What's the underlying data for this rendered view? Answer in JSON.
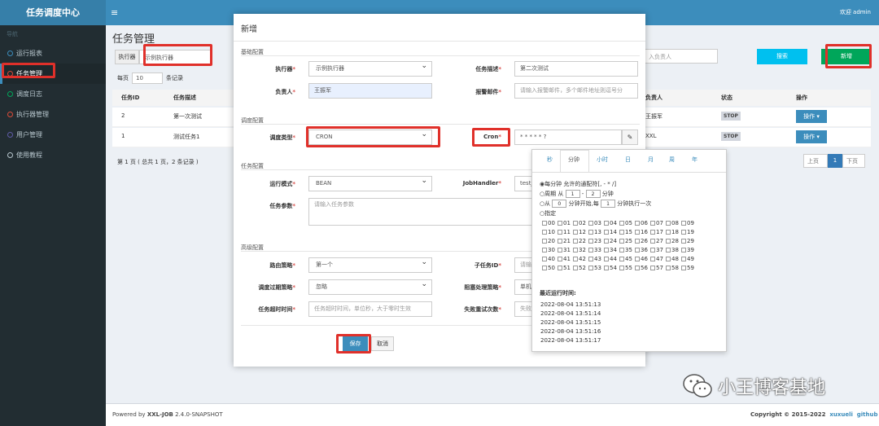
{
  "app": {
    "logo": "任务调度中心",
    "welcome": "欢迎 admin"
  },
  "sidebar": {
    "header": "导航",
    "items": [
      {
        "label": "运行报表",
        "color": "#3c8dbc"
      },
      {
        "label": "任务管理",
        "color": "#dd4b39"
      },
      {
        "label": "调度日志",
        "color": "#00a65a"
      },
      {
        "label": "执行器管理",
        "color": "#dd4b39"
      },
      {
        "label": "用户管理",
        "color": "#605ca8"
      },
      {
        "label": "使用教程",
        "color": "#b8c7ce"
      }
    ]
  },
  "page": {
    "title": "任务管理",
    "executor_label": "执行器",
    "executor_value": "示例执行器",
    "owner_placeholder": "入负责人",
    "search_btn": "搜索",
    "add_btn": "新增"
  },
  "table": {
    "per_page_prefix": "每页",
    "per_page_value": "10",
    "per_page_suffix": "条记录",
    "headers": [
      "任务ID",
      "任务描述",
      "负责人",
      "状态",
      "操作"
    ],
    "rows": [
      {
        "id": "2",
        "desc": "第一次测试",
        "owner": "王振军",
        "status": "STOP",
        "action": "操作"
      },
      {
        "id": "1",
        "desc": "测试任务1",
        "owner": "XXL",
        "status": "STOP",
        "action": "操作"
      }
    ],
    "summary": "第 1 页 ( 总共 1 页，2 条记录 )",
    "pager": {
      "prev": "上页",
      "page": "1",
      "next": "下页"
    }
  },
  "modal": {
    "title": "新增",
    "sections": {
      "basic": "基础配置",
      "schedule": "调度配置",
      "task": "任务配置",
      "advanced": "高级配置"
    },
    "fields": {
      "executor": {
        "label": "执行器",
        "value": "示例执行器"
      },
      "desc": {
        "label": "任务描述",
        "value": "第二次测试"
      },
      "owner": {
        "label": "负责人",
        "value": "王振军"
      },
      "email": {
        "label": "报警邮件",
        "placeholder": "请输入报警邮件，多个邮件地址则逗号分"
      },
      "schedule_type": {
        "label": "调度类型",
        "value": "CRON"
      },
      "cron": {
        "label": "Cron",
        "value": "* * * * * ?"
      },
      "run_mode": {
        "label": "运行模式",
        "value": "BEAN"
      },
      "handler": {
        "label": "JobHandler",
        "value": "testJ"
      },
      "params": {
        "label": "任务参数",
        "placeholder": "请输入任务参数"
      },
      "route": {
        "label": "路由策略",
        "value": "第一个"
      },
      "child": {
        "label": "子任务ID",
        "placeholder": "请输"
      },
      "misfire": {
        "label": "调度过期策略",
        "value": "忽略"
      },
      "block": {
        "label": "阻塞处理策略",
        "value": "单机"
      },
      "timeout": {
        "label": "任务超时时间",
        "placeholder": "任务超时时间，单位秒，大于零时生效"
      },
      "retry": {
        "label": "失败重试次数",
        "placeholder": "失败"
      }
    },
    "save": "保存",
    "cancel": "取消"
  },
  "cron_popover": {
    "tabs": [
      "秒",
      "分钟",
      "小时",
      "日",
      "月",
      "周",
      "年"
    ],
    "opt_every": "每分钟 允许的通配符[, - * /]",
    "opt_cycle_a": "周期 从",
    "cycle_from": "1",
    "cycle_to": "2",
    "opt_cycle_b": "分钟",
    "opt_from_a": "从",
    "from_val": "0",
    "opt_from_b": "分钟开始,每",
    "every_val": "1",
    "opt_from_c": "分钟执行一次",
    "opt_specify": "指定",
    "minutes": [
      "00",
      "01",
      "02",
      "03",
      "04",
      "05",
      "06",
      "07",
      "08",
      "09",
      "10",
      "11",
      "12",
      "13",
      "14",
      "15",
      "16",
      "17",
      "18",
      "19",
      "20",
      "21",
      "22",
      "23",
      "24",
      "25",
      "26",
      "27",
      "28",
      "29",
      "30",
      "31",
      "32",
      "33",
      "34",
      "35",
      "36",
      "37",
      "38",
      "39",
      "40",
      "41",
      "42",
      "43",
      "44",
      "45",
      "46",
      "47",
      "48",
      "49",
      "50",
      "51",
      "52",
      "53",
      "54",
      "55",
      "56",
      "57",
      "58",
      "59"
    ],
    "recent_title": "最近运行时间:",
    "recent": [
      "2022-08-04 13:51:13",
      "2022-08-04 13:51:14",
      "2022-08-04 13:51:15",
      "2022-08-04 13:51:16",
      "2022-08-04 13:51:17"
    ]
  },
  "footer": {
    "powered": "Powered by",
    "brand": "XXL-JOB",
    "version": "2.4.0-SNAPSHOT",
    "copyright": "Copyright © 2015-2022",
    "author": "xuxueli",
    "github": "github"
  },
  "watermark": "小王博客基地"
}
